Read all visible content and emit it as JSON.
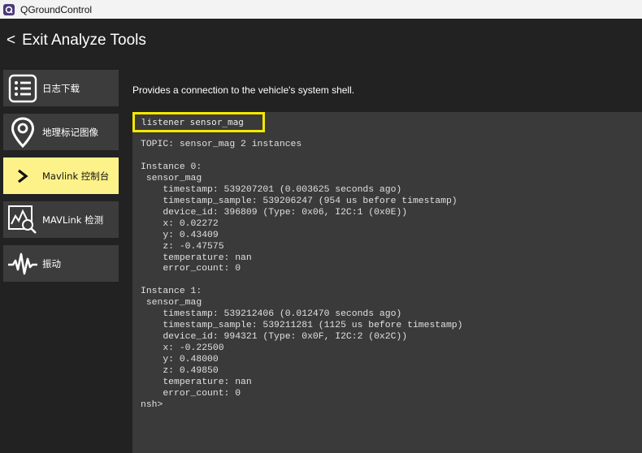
{
  "window": {
    "title": "QGroundControl",
    "app_icon": "qgc-logo-icon"
  },
  "header": {
    "back_chevron": "<",
    "back_label": "Exit Analyze Tools"
  },
  "sidebar": {
    "items": [
      {
        "label": "日志下载",
        "icon": "list-icon",
        "active": false
      },
      {
        "label": "地理标记图像",
        "icon": "map-pin-icon",
        "active": false
      },
      {
        "label": "Mavlink 控制台",
        "icon": "chevron-right-icon",
        "active": true
      },
      {
        "label": "MAVLink 检测",
        "icon": "chart-magnifier-icon",
        "active": false
      },
      {
        "label": "振动",
        "icon": "vibration-wave-icon",
        "active": false
      }
    ]
  },
  "colors": {
    "background": "#222222",
    "nav_item": "#3c3c3c",
    "nav_active": "#fdf28a",
    "console_bg": "#3a3a3a",
    "input_highlight": "#f5e800"
  },
  "main": {
    "description": "Provides a connection to the vehicle's system shell."
  },
  "console": {
    "command": "listener sensor_mag",
    "output": "TOPIC: sensor_mag 2 instances\n\nInstance 0:\n sensor_mag\n    timestamp: 539207201 (0.003625 seconds ago)\n    timestamp_sample: 539206247 (954 us before timestamp)\n    device_id: 396809 (Type: 0x06, I2C:1 (0x0E))\n    x: 0.02272\n    y: 0.43409\n    z: -0.47575\n    temperature: nan\n    error_count: 0\n\nInstance 1:\n sensor_mag\n    timestamp: 539212406 (0.012470 seconds ago)\n    timestamp_sample: 539211281 (1125 us before timestamp)\n    device_id: 994321 (Type: 0x0F, I2C:2 (0x2C))\n    x: -0.22500\n    y: 0.48000\n    z: 0.49850\n    temperature: nan\n    error_count: 0\nnsh>"
  }
}
